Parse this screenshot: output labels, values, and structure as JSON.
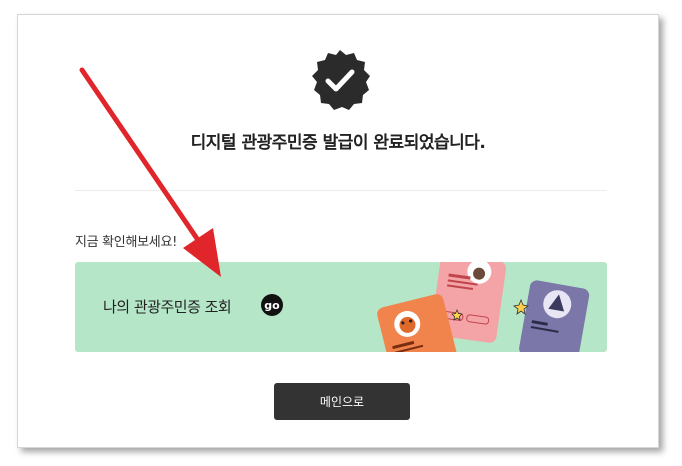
{
  "headline": "디지털 관광주민증 발급이 완료되었습니다.",
  "section_label": "지금 확인해보세요!",
  "banner": {
    "text": "나의 관광주민증 조회",
    "go_badge": "go"
  },
  "main_button": "메인으로",
  "colors": {
    "banner_bg": "#b5e6c8",
    "badge": "#2b2b2b",
    "button_bg": "#333333",
    "arrow": "#e0262b"
  },
  "icons": [
    "check-badge-icon",
    "go-icon",
    "red-arrow-annotation"
  ]
}
